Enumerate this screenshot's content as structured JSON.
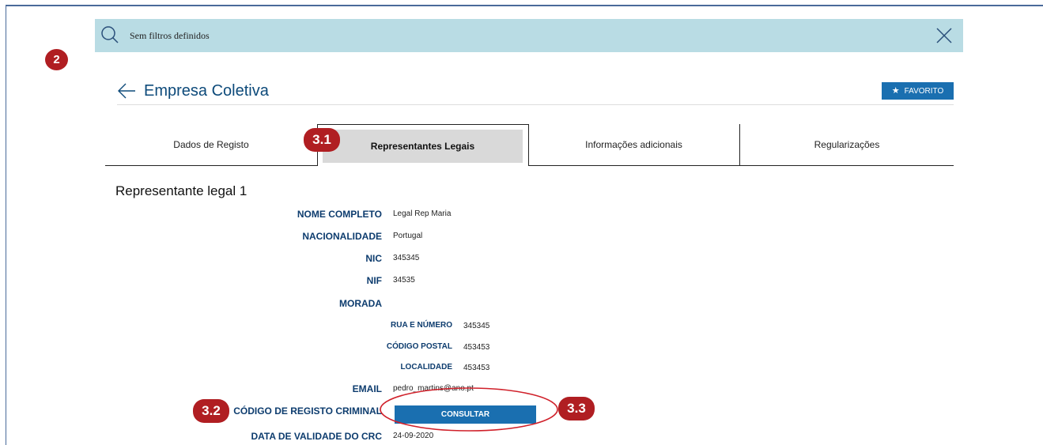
{
  "search": {
    "placeholder": "Sem filtros definidos",
    "icon": "search-icon",
    "close_icon": "close-icon"
  },
  "annotations": [
    "2",
    "3.1",
    "3.2",
    "3.3"
  ],
  "header": {
    "title": "Empresa Coletiva",
    "favorite_label": "FAVORITO"
  },
  "tabs": [
    {
      "label": "Dados de Registo"
    },
    {
      "label": "Representantes Legais",
      "active": true
    },
    {
      "label": "Informações adicionais"
    },
    {
      "label": "Regularizações"
    }
  ],
  "representative": {
    "heading": "Representante legal 1",
    "fields": [
      {
        "label": "NOME COMPLETO",
        "value": "Legal Rep Maria"
      },
      {
        "label": "NACIONALIDADE",
        "value": "Portugal"
      },
      {
        "label": "NIC",
        "value": "345345"
      },
      {
        "label": "NIF",
        "value": "34535"
      },
      {
        "label": "MORADA",
        "value": ""
      },
      {
        "label": "RUA E NÚMERO",
        "value": "345345"
      },
      {
        "label": "CÓDIGO POSTAL",
        "value": "453453"
      },
      {
        "label": "LOCALIDADE",
        "value": "453453"
      },
      {
        "label": "EMAIL",
        "value": "pedro_martins@ano.pt"
      },
      {
        "label": "CÓDIGO DE REGISTO CRIMINAL",
        "value": ""
      },
      {
        "label": "DATA DE VALIDADE DO CRC",
        "value": "24-09-2020"
      }
    ],
    "consult_label": "CONSULTAR"
  },
  "colors": {
    "accent": "#1a6fb0",
    "badge": "#b01e22",
    "search_bg": "#b9dce4",
    "label": "#0d3c6e"
  }
}
